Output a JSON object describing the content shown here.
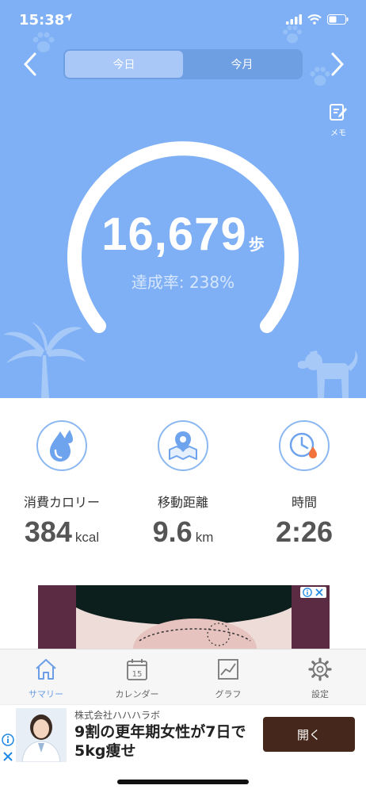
{
  "status_bar": {
    "time": "15:38"
  },
  "segment": {
    "today": "今日",
    "month": "今月"
  },
  "memo": {
    "label": "メモ"
  },
  "summary": {
    "steps": "16,679",
    "steps_unit": "歩",
    "achievement": "達成率: 238%",
    "achievement_fraction": 2.38
  },
  "stats": {
    "calories": {
      "label": "消費カロリー",
      "value": "384",
      "unit": "kcal"
    },
    "distance": {
      "label": "移動距離",
      "value": "9.6",
      "unit": "km"
    },
    "time": {
      "label": "時間",
      "value": "2:26"
    }
  },
  "tabs": [
    {
      "label": "サマリー",
      "icon": "home-icon"
    },
    {
      "label": "カレンダー",
      "icon": "calendar-icon",
      "badge": "15"
    },
    {
      "label": "グラフ",
      "icon": "graph-icon"
    },
    {
      "label": "設定",
      "icon": "gear-icon"
    }
  ],
  "ad": {
    "company": "株式会社ハハハラボ",
    "headline": "9割の更年期女性が7日で5kg痩せ",
    "button": "開く"
  },
  "colors": {
    "hero": "#7fb0f5",
    "accent": "#6c9ee8",
    "ad_button": "#45281b"
  }
}
